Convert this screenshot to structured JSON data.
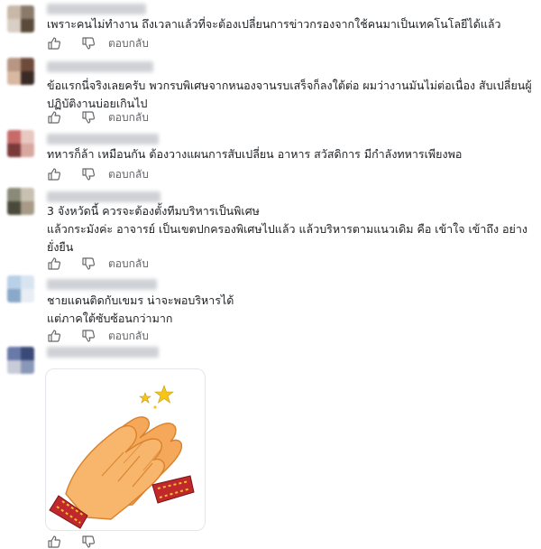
{
  "comments": [
    {
      "text": "เพราะคนไม่ทำงาน ถึงเวลาแล้วที่จะต้องเปลี่ยนการข่าวกรองจากใช้คนมาเป็นเทคโนโลยีได้แล้ว",
      "reply_label": "ตอบกลับ",
      "avatar_colors": [
        "#c8b8a8",
        "#8a7a6a",
        "#d9cfc4",
        "#5a4a3c"
      ]
    },
    {
      "text": "ข้อแรกนี่จริงเลยครับ พวกรบพิเศษจากหนองจานรบเสร็จก็ลงใต้ต่อ ผมว่างานมันไม่ต่อเนื่อง สับเปลี่ยนผู้ปฏิบัติงานบ่อยเกินไป",
      "reply_label": "ตอบกลับ",
      "avatar_colors": [
        "#b89684",
        "#6e4a3a",
        "#d8b8a0",
        "#3a2a24"
      ]
    },
    {
      "text": "ทหารก็ล้า เหมือนกัน ต้องวางแผนการสับเปลี่ยน อาหาร สวัสดิการ มีกำลังทหารเพียงพอ",
      "reply_label": "ตอบกลับ",
      "avatar_colors": [
        "#c86a6a",
        "#e8c8c0",
        "#7a3a3a",
        "#d8a8a0"
      ]
    },
    {
      "text": "3 จังหวัดนี้ ควรจะต้องตั้งทีมบริหารเป็นพิเศษ\nแล้วกระมังค่ะ อาจารย์ เป็นเขตปกครองพิเศษไปแล้ว แล้วบริหารตามแนวเดิม คือ เข้าใจ เข้าถึง อย่างยั่งยืน",
      "reply_label": "ตอบกลับ",
      "avatar_colors": [
        "#8a8a78",
        "#c8c0b0",
        "#4a4a3c",
        "#a89a88"
      ]
    },
    {
      "text": "ชายแดนติดกับเขมร น่าจะพอบริหารได้\nแต่ภาคใต้ซับซ้อนกว่ามาก",
      "reply_label": "ตอบกลับ",
      "avatar_colors": [
        "#b8d0e8",
        "#d8e4f0",
        "#8aa8c8",
        "#e8eef4"
      ]
    },
    {
      "text": "",
      "reply_label": "",
      "avatar_colors": [
        "#6a7aa8",
        "#3a4a78",
        "#c8ccd8",
        "#8a98b8"
      ]
    }
  ],
  "icons": {
    "like": "thumbs-up-icon",
    "dislike": "thumbs-down-icon"
  },
  "sticker": {
    "name": "wai-hands-sticker",
    "skin": "#f5a85a",
    "skin_dark": "#d9822e",
    "cuff": "#c0282c",
    "cuff_gold": "#f2c230",
    "star": "#f5c518"
  },
  "colors": {
    "text": "#1c1e21",
    "muted": "#65676b",
    "placeholder": "#c9ccd1"
  }
}
